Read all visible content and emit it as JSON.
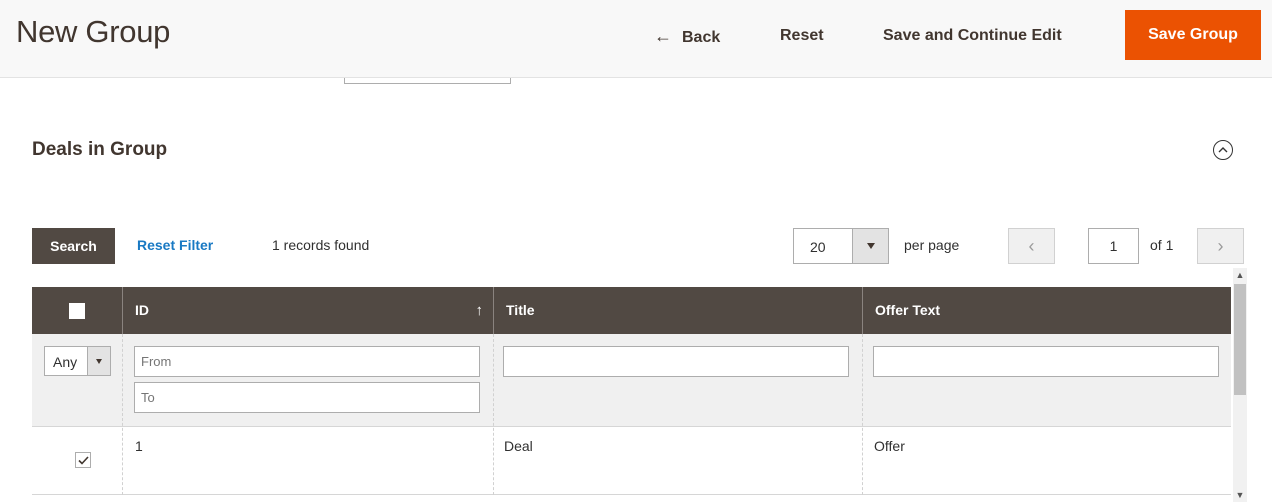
{
  "header": {
    "title": "New Group",
    "back_label": "Back",
    "reset_label": "Reset",
    "save_continue_label": "Save and Continue Edit",
    "save_label": "Save Group"
  },
  "section": {
    "title": "Deals in Group"
  },
  "toolbar": {
    "search_label": "Search",
    "reset_filter_label": "Reset Filter",
    "records_found": "1 records found",
    "per_page_value": "20",
    "per_page_label": "per page",
    "current_page": "1",
    "page_total": "of 1"
  },
  "grid": {
    "columns": {
      "id": "ID",
      "title": "Title",
      "offer_text": "Offer Text"
    },
    "sort_indicator": "↑",
    "filters": {
      "select_value": "Any",
      "id_from_placeholder": "From",
      "id_to_placeholder": "To",
      "title_value": "",
      "offer_text_value": ""
    },
    "rows": [
      {
        "checked": true,
        "id": "1",
        "title": "Deal",
        "offer_text": "Offer"
      }
    ]
  },
  "colors": {
    "accent": "#eb5202",
    "grid_header": "#514943",
    "link": "#1979c3"
  },
  "icons": {
    "back": "arrow-left-icon",
    "collapse": "chevron-up-circle-icon",
    "prev": "chevron-left-icon",
    "next": "chevron-right-icon"
  }
}
